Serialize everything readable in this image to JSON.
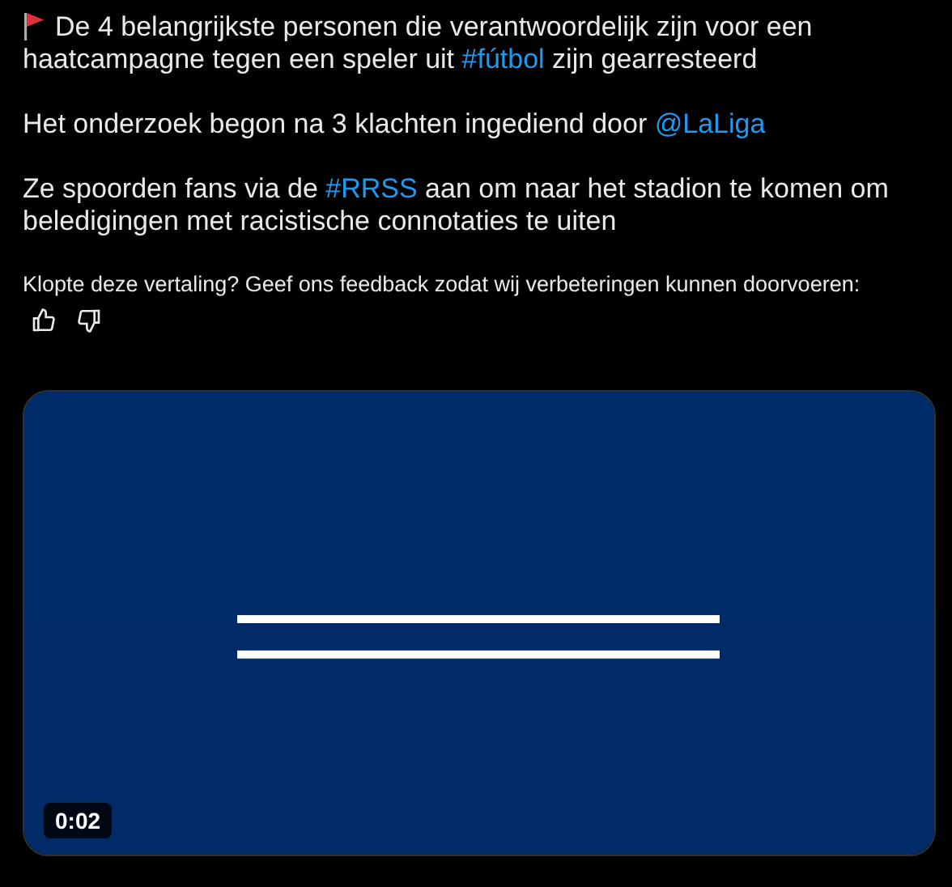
{
  "post": {
    "paragraphs": [
      {
        "flag": true,
        "segments": [
          {
            "kind": "text",
            "text": "De 4 belangrijkste personen die verantwoordelijk zijn voor een haatcampagne tegen een speler uit "
          },
          {
            "kind": "link",
            "text": "#fútbol"
          },
          {
            "kind": "text",
            "text": " zijn gearresteerd"
          }
        ]
      },
      {
        "flag": false,
        "segments": [
          {
            "kind": "text",
            "text": "Het onderzoek begon na 3 klachten ingediend door "
          },
          {
            "kind": "link",
            "text": "@LaLiga"
          }
        ]
      },
      {
        "flag": false,
        "segments": [
          {
            "kind": "text",
            "text": "Ze spoorden fans via de "
          },
          {
            "kind": "link",
            "text": "#RRSS"
          },
          {
            "kind": "text",
            "text": " aan om naar het stadion te komen om beledigingen met racistische connotaties te uiten"
          }
        ]
      }
    ]
  },
  "translation_feedback": {
    "prompt": "Klopte deze vertaling? Geef ons feedback zodat wij verbeteringen kunnen doorvoeren:"
  },
  "video": {
    "kind": "picture",
    "duration": "0:02"
  }
}
